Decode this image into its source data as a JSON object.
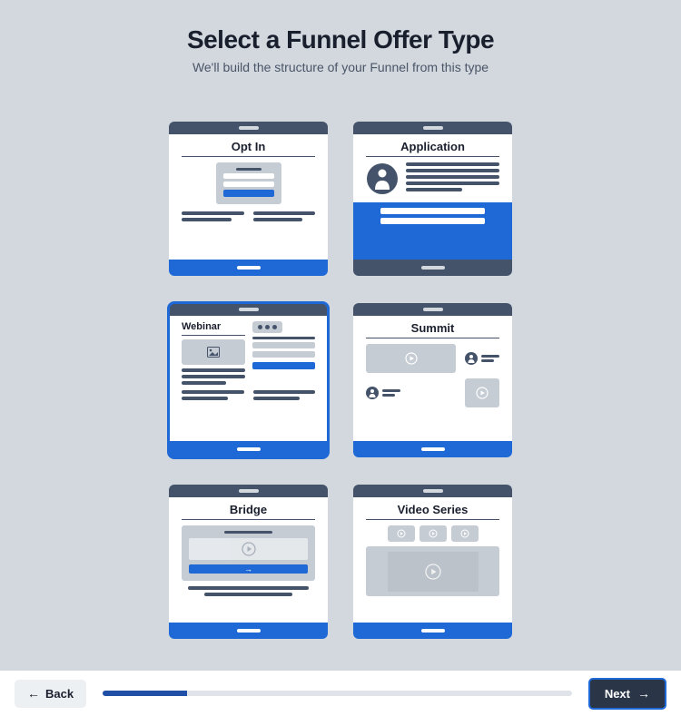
{
  "header": {
    "title": "Select a Funnel Offer Type",
    "subtitle": "We'll build the structure of your Funnel from this type"
  },
  "cards": {
    "optin": {
      "label": "Opt In"
    },
    "application": {
      "label": "Application"
    },
    "webinar": {
      "label": "Webinar"
    },
    "summit": {
      "label": "Summit"
    },
    "bridge": {
      "label": "Bridge"
    },
    "video_series": {
      "label": "Video Series"
    }
  },
  "selected_card": "webinar",
  "footer": {
    "back_label": "Back",
    "next_label": "Next",
    "progress_percent": 18
  },
  "icons": {
    "arrow_left": "←",
    "arrow_right": "→"
  },
  "colors": {
    "accent": "#1f69d6",
    "panel": "#44536a",
    "bg": "#d2d8de",
    "muted": "#c5ccd4"
  }
}
